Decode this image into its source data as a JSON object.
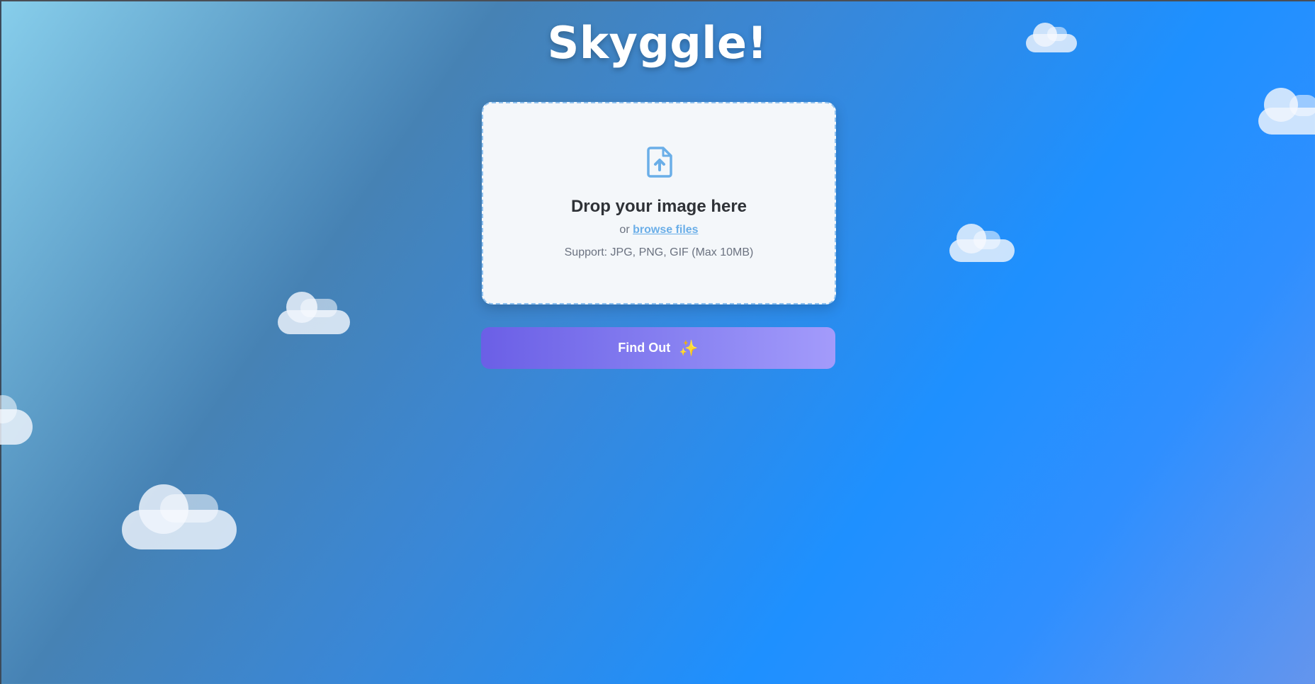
{
  "app": {
    "title": "Skyggle!"
  },
  "dropzone": {
    "heading": "Drop your image here",
    "or_text": "or",
    "browse_label": "browse files",
    "support_text": "Support: JPG, PNG, GIF (Max 10MB)",
    "icon": "file-upload-icon"
  },
  "actions": {
    "find_out_label": "Find Out",
    "find_out_icon": "sparkle-icon"
  },
  "colors": {
    "accent_link": "#6aaee8",
    "button_start": "#6b5fe6",
    "button_end": "#a39bfb",
    "sky_primary": "#1e90ff"
  }
}
